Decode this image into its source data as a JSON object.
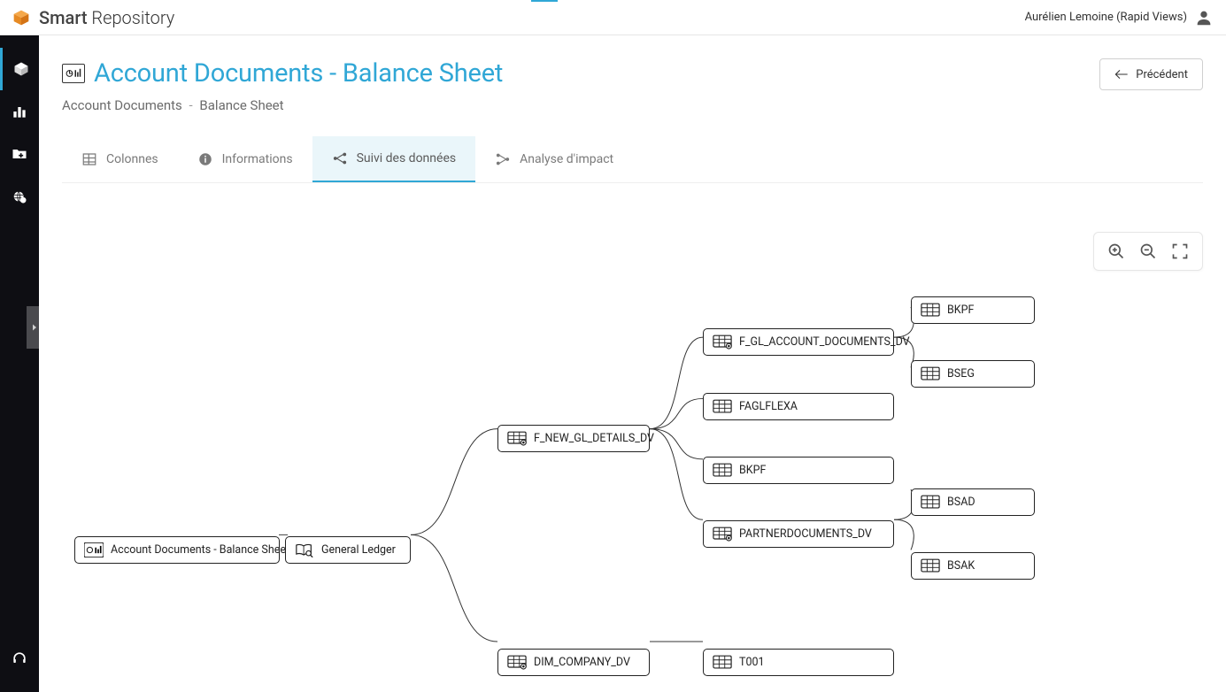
{
  "brand": {
    "strong": "Smart",
    "light": " Repository"
  },
  "user": {
    "name": "Aurélien Lemoine (Rapid Views)"
  },
  "page": {
    "title": "Account Documents - Balance Sheet",
    "breadcrumb": {
      "a": "Account Documents",
      "b": "Balance Sheet"
    },
    "back_label": "Précédent"
  },
  "tabs": {
    "columns": "Colonnes",
    "info": "Informations",
    "lineage": "Suivi des données",
    "impact": "Analyse d'impact"
  },
  "nodes": {
    "root": "Account Documents - Balance Sheet",
    "ledger": "General Ledger",
    "gl_details": "F_NEW_GL_DETAILS_DV",
    "company": "DIM_COMPANY_DV",
    "acc_docs": "F_GL_ACCOUNT_DOCUMENTS_DV",
    "faglflexa": "FAGLFLEXA",
    "bkpf2": "BKPF",
    "partner": "PARTNERDOCUMENTS_DV",
    "bkpf1": "BKPF",
    "bseg": "BSEG",
    "bsad": "BSAD",
    "bsak": "BSAK",
    "t001": "T001"
  }
}
